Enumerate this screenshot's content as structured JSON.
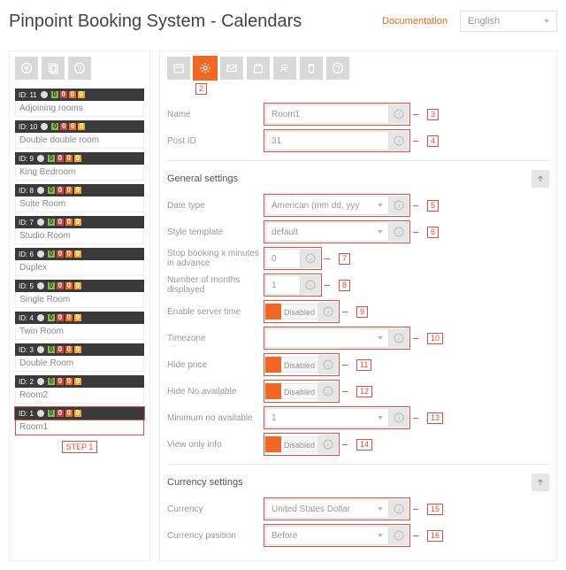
{
  "header": {
    "title": "Pinpoint Booking System - Calendars",
    "doc_link": "Documentation",
    "language": "English"
  },
  "sidebar": {
    "step_label": "STEP 1",
    "items": [
      {
        "id": "ID: 11",
        "name": "Adjoining rooms",
        "b": [
          "0",
          "0",
          "0",
          "0"
        ]
      },
      {
        "id": "ID: 10",
        "name": "Double double room",
        "b": [
          "0",
          "0",
          "0",
          "0"
        ]
      },
      {
        "id": "ID: 9",
        "name": "King Bedroom",
        "b": [
          "0",
          "0",
          "0",
          "0"
        ]
      },
      {
        "id": "ID: 8",
        "name": "Suite Room",
        "b": [
          "0",
          "0",
          "0",
          "0"
        ]
      },
      {
        "id": "ID: 7",
        "name": "Studio Room",
        "b": [
          "0",
          "0",
          "0",
          "0"
        ]
      },
      {
        "id": "ID: 6",
        "name": "Duplex",
        "b": [
          "0",
          "0",
          "0",
          "0"
        ]
      },
      {
        "id": "ID: 5",
        "name": "Single Room",
        "b": [
          "0",
          "0",
          "0",
          "0"
        ]
      },
      {
        "id": "ID: 4",
        "name": "Twin Room",
        "b": [
          "0",
          "0",
          "0",
          "0"
        ]
      },
      {
        "id": "ID: 3",
        "name": "Double Room",
        "b": [
          "0",
          "0",
          "0",
          "0"
        ]
      },
      {
        "id": "ID: 2",
        "name": "Room2",
        "b": [
          "0",
          "0",
          "0",
          "0"
        ]
      },
      {
        "id": "ID: 1",
        "name": "Room1",
        "b": [
          "0",
          "0",
          "0",
          "0"
        ]
      }
    ],
    "selected_index": 10
  },
  "annotations": {
    "toolbar": "2",
    "name": "3",
    "post_id": "4",
    "date_type": "5",
    "style_template": "6",
    "stop_booking": "7",
    "months": "8",
    "server_time": "9",
    "timezone": "10",
    "hide_price": "11",
    "hide_no_avail": "12",
    "min_no_avail": "13",
    "view_only": "14",
    "currency": "15",
    "currency_pos": "16"
  },
  "form": {
    "name": {
      "label": "Name",
      "value": "Room1"
    },
    "post_id": {
      "label": "Post ID",
      "value": "31"
    },
    "general_title": "General settings",
    "date_type": {
      "label": "Date type",
      "value": "American (mm dd, yyy"
    },
    "style_template": {
      "label": "Style template",
      "value": "default"
    },
    "stop_booking": {
      "label": "Stop booking x minutes in advance",
      "value": "0"
    },
    "months": {
      "label": "Number of months displayed",
      "value": "1"
    },
    "server_time": {
      "label": "Enable server time",
      "value": "Disabled"
    },
    "timezone": {
      "label": "Timezone",
      "value": ""
    },
    "hide_price": {
      "label": "Hide price",
      "value": "Disabled"
    },
    "hide_no_avail": {
      "label": "Hide No available",
      "value": "Disabled"
    },
    "min_no_avail": {
      "label": "Minimum no available",
      "value": "1"
    },
    "view_only": {
      "label": "View only info",
      "value": "Disabled"
    },
    "currency_title": "Currency settings",
    "currency": {
      "label": "Currency",
      "value": "United States Dollar"
    },
    "currency_pos": {
      "label": "Currency position",
      "value": "Before"
    }
  }
}
